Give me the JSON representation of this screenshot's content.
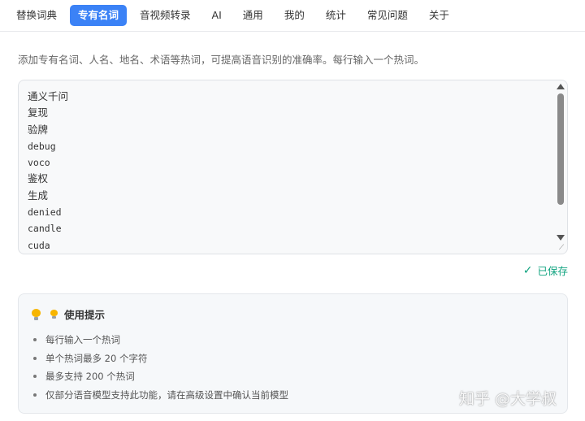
{
  "tabs": [
    {
      "label": "替换词典",
      "active": false
    },
    {
      "label": "专有名词",
      "active": true
    },
    {
      "label": "音视频转录",
      "active": false
    },
    {
      "label": "AI",
      "active": false
    },
    {
      "label": "通用",
      "active": false
    },
    {
      "label": "我的",
      "active": false
    },
    {
      "label": "统计",
      "active": false
    },
    {
      "label": "常见问题",
      "active": false
    },
    {
      "label": "关于",
      "active": false
    }
  ],
  "description": "添加专有名词、人名、地名、术语等热词，可提高语音识别的准确率。每行输入一个热词。",
  "hotwords": [
    "通义千问",
    "复现",
    "验牌",
    "debug",
    "voco",
    "鉴权",
    "生成",
    "denied",
    "candle",
    "cuda"
  ],
  "status": {
    "saved_label": "已保存",
    "icon": "check-icon",
    "color": "#10a37f"
  },
  "tips": {
    "title": "使用提示",
    "items": [
      "每行输入一个热词",
      "单个热词最多 20 个字符",
      "最多支持 200 个热词",
      "仅部分语音模型支持此功能，请在高级设置中确认当前模型"
    ]
  },
  "watermark": "知乎 @大学叔",
  "colors": {
    "accent": "#3b82f6",
    "success": "#10a37f"
  }
}
